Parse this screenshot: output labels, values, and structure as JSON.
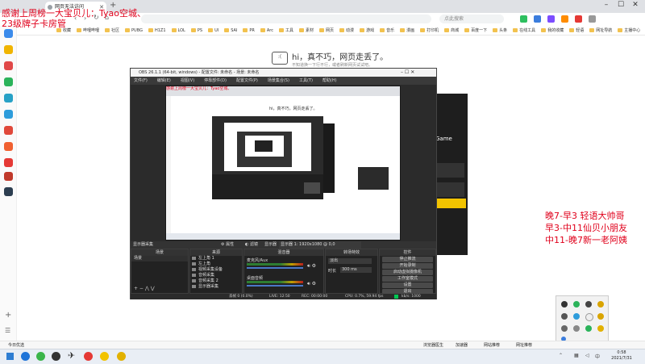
{
  "overlay": {
    "line1": "感谢上周榜一大宝贝儿：Tyao空城、",
    "line2": "23级牌子卡房管"
  },
  "schedule": {
    "line1": "晚7-早3  轻语大帅哥",
    "line2": "早3-中11仙贝小朋友",
    "line3": "中11-晚7新一老阿姨"
  },
  "browser": {
    "tab_title": "网页无法访问",
    "new_tab": "+",
    "url": "",
    "search_placeholder": "点此搜索",
    "bookmarks": [
      "收藏",
      "哔哩哔哩",
      "社区",
      "PUBG",
      "H1Z1",
      "LOL",
      "PS",
      "UI",
      "SAI",
      "PR",
      "Arc",
      "工具",
      "素材",
      "网页",
      "动漫",
      "游戏",
      "音乐",
      "漫画",
      "打印机",
      "商城",
      "百度一下",
      "头条",
      "在线工具",
      "我的收藏",
      "轻语",
      "网址导航",
      "主播中心",
      "轻语"
    ]
  },
  "error_page": {
    "face": ":(",
    "title": "hi，真不巧，网页走丢了。",
    "subtitle": "不知道换一下行不行，或者刷新网页试试吧。"
  },
  "obs": {
    "title": "OBS 26.1.1 (64-bit, windows) - 配置文件: 未命名 - 场景: 未命名",
    "menu": [
      "文件(F)",
      "编辑(E)",
      "视图(V)",
      "停靠部件(D)",
      "配置文件(P)",
      "场景集合(S)",
      "工具(T)",
      "帮助(H)"
    ],
    "source_bar": {
      "source_name": "显示器采集",
      "properties": "属性",
      "filters": "滤镜",
      "display_label": "显示器",
      "display_value": "显示器 1: 1920x1080 @ 0,0"
    },
    "panels": {
      "scenes_title": "场景",
      "scene_item": "场景",
      "sources_title": "来源",
      "sources": [
        "左上角 1",
        "左上角",
        "视频采集设备",
        "音频采集",
        "音频采集 2",
        "显示器采集"
      ],
      "mixer_title": "混音器",
      "mixer_tracks": [
        "麦克风/Aux",
        "桌面音频"
      ],
      "transition_title": "转场特效",
      "transition_type": "淡出",
      "duration_label": "时长",
      "duration_value": "300 ms",
      "controls_title": "控件",
      "controls": [
        "停止推流",
        "开始录制",
        "启动虚拟摄像机",
        "工作室模式",
        "设置",
        "退出"
      ]
    },
    "status": [
      "丢帧 0 (0.0%)",
      "LIVE: 12:50",
      "REC: 00:00:00",
      "CPU: 0.7%, 59.94 fps",
      "kb/s: 1000"
    ]
  },
  "game": {
    "label": "Game"
  },
  "status_bar": {
    "left": "今日优选",
    "items": [
      "浏览器医生",
      "加速器",
      "网站推荐",
      "网址推荐"
    ]
  },
  "taskbar": {
    "time": "0:58",
    "date": "2021/7/31"
  },
  "colors": {
    "overlay_red": "#e0001b",
    "obs_dark": "#2b2b2b",
    "live_green": "#00c853"
  }
}
